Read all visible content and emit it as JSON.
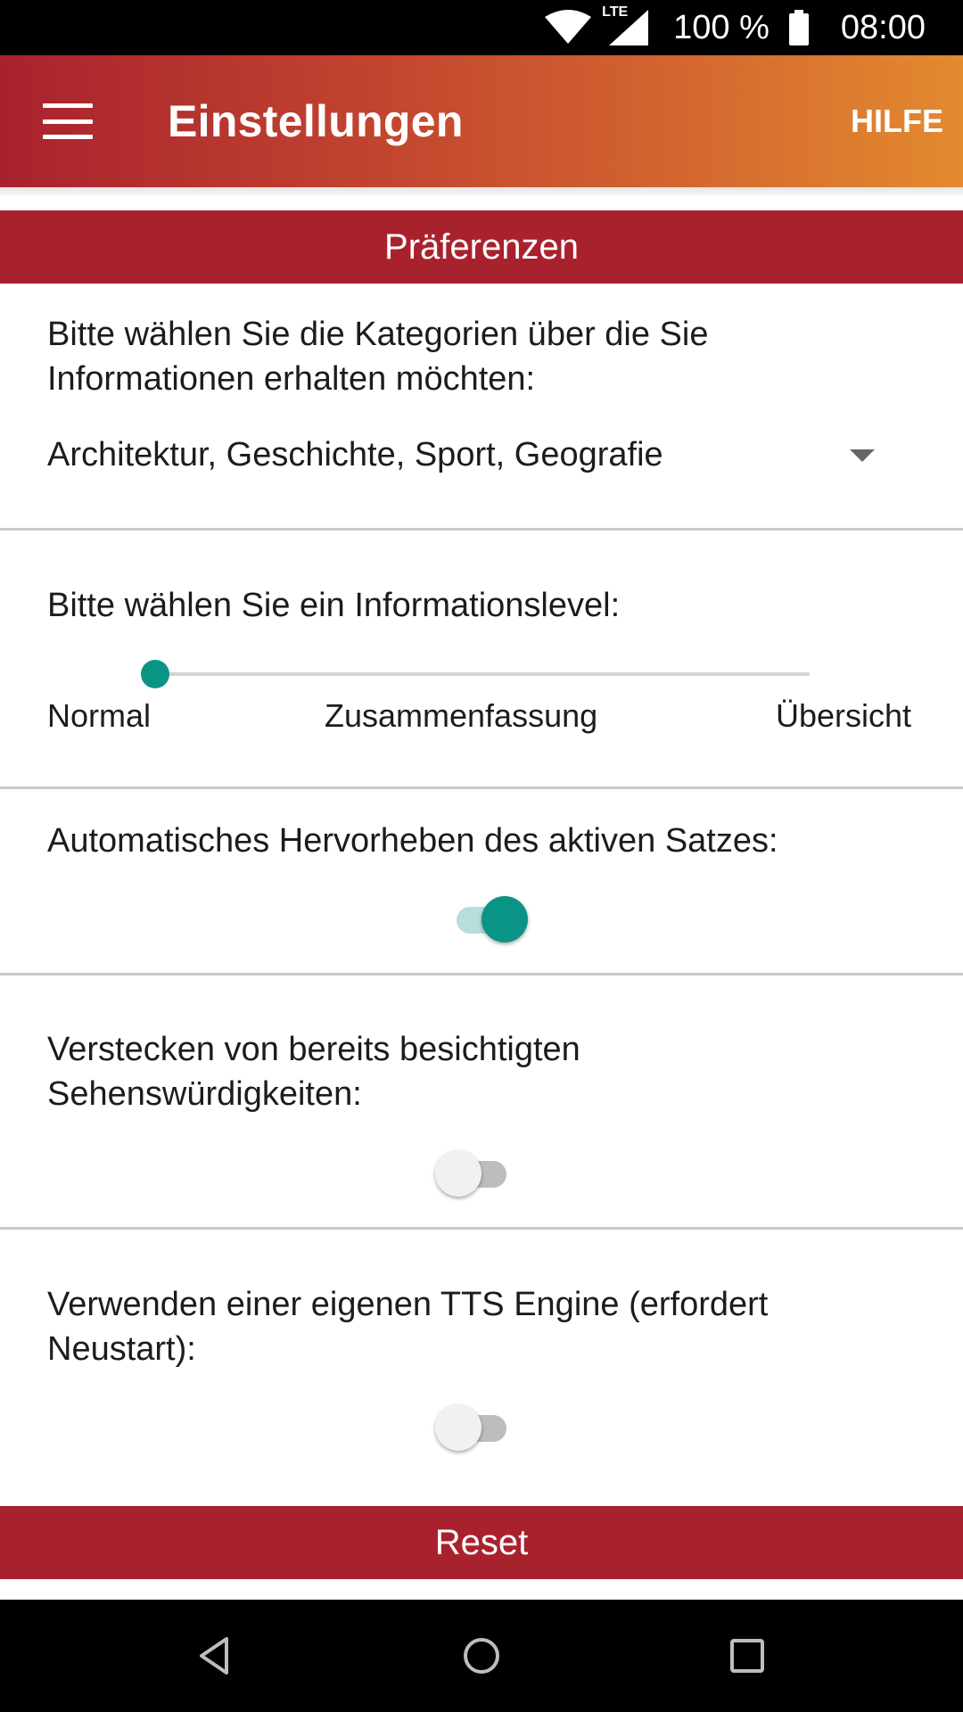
{
  "status_bar": {
    "network": "LTE",
    "battery_text": "100 %",
    "time": "08:00",
    "icons": [
      "wifi-icon",
      "lte-signal-icon",
      "battery-icon"
    ]
  },
  "app_bar": {
    "menu_icon": "hamburger-menu-icon",
    "title": "Einstellungen",
    "help_label": "HILFE",
    "gradient": [
      "#a8222e",
      "#e38a2f"
    ]
  },
  "section_header": "Präferenzen",
  "categories": {
    "label": "Bitte wählen Sie die Kategorien über die Sie Informationen erhalten möchten:",
    "selected_value": "Architektur, Geschichte, Sport, Geografie",
    "arrow_icon": "dropdown-arrow-icon"
  },
  "info_level": {
    "label": "Bitte wählen Sie ein Informationslevel:",
    "options": [
      "Normal",
      "Zusammenfassung",
      "Übersicht"
    ],
    "selected_index": 0,
    "accent_color": "#0a9486"
  },
  "highlight_sentence": {
    "label": "Automatisches Hervorheben des aktiven Satzes:",
    "enabled": true
  },
  "hide_visited": {
    "label": "Verstecken von bereits besichtigten Sehenswürdigkeiten:",
    "enabled": false
  },
  "own_tts": {
    "label": "Verwenden einer eigenen TTS Engine (erfordert Neustart):",
    "enabled": false
  },
  "reset_label": "Reset",
  "nav_bar": {
    "icons": [
      "back-icon",
      "home-icon",
      "recents-icon"
    ]
  },
  "colors": {
    "primary": "#a8222e",
    "accent": "#0a9486"
  }
}
